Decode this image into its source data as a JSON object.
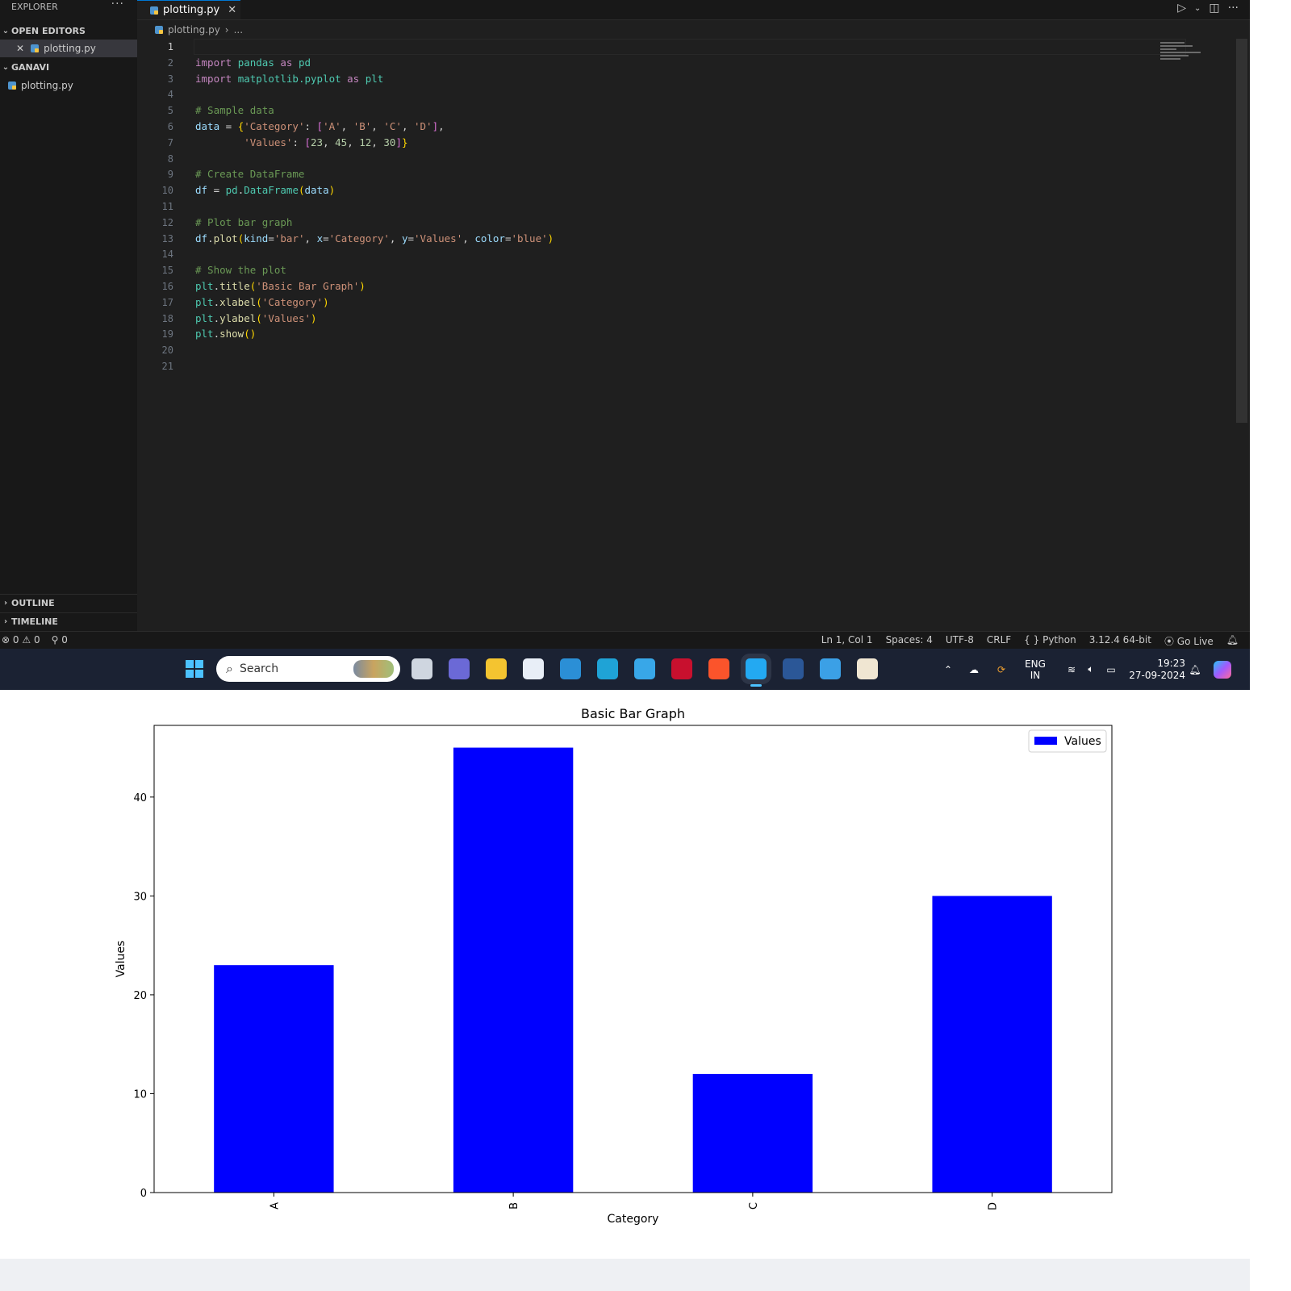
{
  "sidebar": {
    "title": "EXPLORER",
    "more": "···",
    "open_editors": {
      "label": "OPEN EDITORS",
      "items": [
        {
          "name": "plotting.py"
        }
      ]
    },
    "folder": {
      "label": "GANAVI",
      "items": [
        {
          "name": "plotting.py"
        }
      ]
    },
    "outline": "OUTLINE",
    "timeline": "TIMELINE"
  },
  "editor": {
    "tab_label": "plotting.py",
    "breadcrumb": {
      "file": "plotting.py",
      "rest": "..."
    },
    "lines": [
      [],
      [
        [
          "kw",
          "import"
        ],
        [
          "op",
          " "
        ],
        [
          "mod",
          "pandas"
        ],
        [
          "op",
          " "
        ],
        [
          "kw",
          "as"
        ],
        [
          "op",
          " "
        ],
        [
          "mod",
          "pd"
        ]
      ],
      [
        [
          "kw",
          "import"
        ],
        [
          "op",
          " "
        ],
        [
          "mod",
          "matplotlib.pyplot"
        ],
        [
          "op",
          " "
        ],
        [
          "kw",
          "as"
        ],
        [
          "op",
          " "
        ],
        [
          "mod",
          "plt"
        ]
      ],
      [],
      [
        [
          "cm",
          "# Sample data"
        ]
      ],
      [
        [
          "var",
          "data"
        ],
        [
          "op",
          " = "
        ],
        [
          "br1",
          "{"
        ],
        [
          "str",
          "'Category'"
        ],
        [
          "op",
          ": "
        ],
        [
          "br2",
          "["
        ],
        [
          "str",
          "'A'"
        ],
        [
          "op",
          ", "
        ],
        [
          "str",
          "'B'"
        ],
        [
          "op",
          ", "
        ],
        [
          "str",
          "'C'"
        ],
        [
          "op",
          ", "
        ],
        [
          "str",
          "'D'"
        ],
        [
          "br2",
          "]"
        ],
        [
          "op",
          ","
        ]
      ],
      [
        [
          "op",
          "        "
        ],
        [
          "str",
          "'Values'"
        ],
        [
          "op",
          ": "
        ],
        [
          "br2",
          "["
        ],
        [
          "num",
          "23"
        ],
        [
          "op",
          ", "
        ],
        [
          "num",
          "45"
        ],
        [
          "op",
          ", "
        ],
        [
          "num",
          "12"
        ],
        [
          "op",
          ", "
        ],
        [
          "num",
          "30"
        ],
        [
          "br2",
          "]"
        ],
        [
          "br1",
          "}"
        ]
      ],
      [],
      [
        [
          "cm",
          "# Create DataFrame"
        ]
      ],
      [
        [
          "var",
          "df"
        ],
        [
          "op",
          " = "
        ],
        [
          "mod",
          "pd"
        ],
        [
          "op",
          "."
        ],
        [
          "mod",
          "DataFrame"
        ],
        [
          "br1",
          "("
        ],
        [
          "var",
          "data"
        ],
        [
          "br1",
          ")"
        ]
      ],
      [],
      [
        [
          "cm",
          "# Plot bar graph"
        ]
      ],
      [
        [
          "var",
          "df"
        ],
        [
          "op",
          "."
        ],
        [
          "fn",
          "plot"
        ],
        [
          "br1",
          "("
        ],
        [
          "var",
          "kind"
        ],
        [
          "op",
          "="
        ],
        [
          "str",
          "'bar'"
        ],
        [
          "op",
          ", "
        ],
        [
          "var",
          "x"
        ],
        [
          "op",
          "="
        ],
        [
          "str",
          "'Category'"
        ],
        [
          "op",
          ", "
        ],
        [
          "var",
          "y"
        ],
        [
          "op",
          "="
        ],
        [
          "str",
          "'Values'"
        ],
        [
          "op",
          ", "
        ],
        [
          "var",
          "color"
        ],
        [
          "op",
          "="
        ],
        [
          "str",
          "'blue'"
        ],
        [
          "br1",
          ")"
        ]
      ],
      [],
      [
        [
          "cm",
          "# Show the plot"
        ]
      ],
      [
        [
          "mod",
          "plt"
        ],
        [
          "op",
          "."
        ],
        [
          "fn",
          "title"
        ],
        [
          "br1",
          "("
        ],
        [
          "str",
          "'Basic Bar Graph'"
        ],
        [
          "br1",
          ")"
        ]
      ],
      [
        [
          "mod",
          "plt"
        ],
        [
          "op",
          "."
        ],
        [
          "fn",
          "xlabel"
        ],
        [
          "br1",
          "("
        ],
        [
          "str",
          "'Category'"
        ],
        [
          "br1",
          ")"
        ]
      ],
      [
        [
          "mod",
          "plt"
        ],
        [
          "op",
          "."
        ],
        [
          "fn",
          "ylabel"
        ],
        [
          "br1",
          "("
        ],
        [
          "str",
          "'Values'"
        ],
        [
          "br1",
          ")"
        ]
      ],
      [
        [
          "mod",
          "plt"
        ],
        [
          "op",
          "."
        ],
        [
          "fn",
          "show"
        ],
        [
          "br1",
          "()"
        ]
      ],
      [],
      []
    ]
  },
  "statusbar": {
    "errors": "0",
    "warnings": "0",
    "ports": "0",
    "position": "Ln 1, Col 1",
    "spaces": "Spaces: 4",
    "encoding": "UTF-8",
    "eol": "CRLF",
    "language": "Python",
    "interpreter": "3.12.4 64-bit",
    "golive": "Go Live"
  },
  "taskbar": {
    "search_placeholder": "Search",
    "lang_top": "ENG",
    "lang_bottom": "IN",
    "time": "19:23",
    "date": "27-09-2024",
    "apps": [
      {
        "name": "task-view-icon",
        "color": "#cfd6e0"
      },
      {
        "name": "teams-icon",
        "color": "#6b69d6"
      },
      {
        "name": "file-explorer-icon",
        "color": "#f4c430"
      },
      {
        "name": "store-icon",
        "color": "#e8eef7"
      },
      {
        "name": "notes-app-icon",
        "color": "#2b8fd6"
      },
      {
        "name": "edge-icon",
        "color": "#1fa3d6"
      },
      {
        "name": "chrome-like-icon",
        "color": "#38a7e8"
      },
      {
        "name": "mcafee-icon",
        "color": "#c8102e"
      },
      {
        "name": "brave-icon",
        "color": "#fb542b"
      },
      {
        "name": "vscode-icon",
        "color": "#23a9f2"
      },
      {
        "name": "word-icon",
        "color": "#2b5797"
      },
      {
        "name": "paint-icon",
        "color": "#3ba0e6"
      },
      {
        "name": "pinwheel-app-icon",
        "color": "#f0e6d2"
      }
    ]
  },
  "chart_data": {
    "type": "bar",
    "title": "Basic Bar Graph",
    "xlabel": "Category",
    "ylabel": "Values",
    "categories": [
      "A",
      "B",
      "C",
      "D"
    ],
    "series": [
      {
        "name": "Values",
        "values": [
          23,
          45,
          12,
          30
        ],
        "color": "#0000ff"
      }
    ],
    "ylim": [
      0,
      47.25
    ],
    "yticks": [
      0,
      10,
      20,
      30,
      40
    ],
    "legend": "top-right",
    "grid": false
  }
}
